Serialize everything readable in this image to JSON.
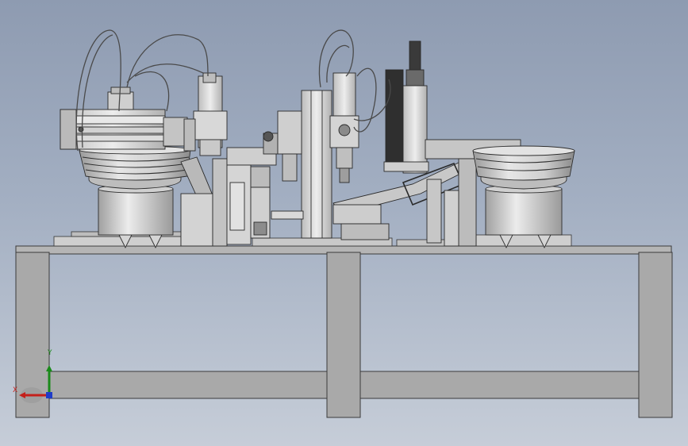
{
  "axes": {
    "x_label": "X",
    "y_label": "Y",
    "x_color": "#c4201b",
    "y_color": "#1a8a1a",
    "z_color": "#1f3cc8"
  },
  "colors": {
    "background_top": "#8e9bb1",
    "background_bottom": "#c6cdd8",
    "frame": "#a9a9a9",
    "frame_edge": "#3a3a3a",
    "steel_light": "#d8d8d8",
    "steel_mid": "#b8b8b8"
  }
}
